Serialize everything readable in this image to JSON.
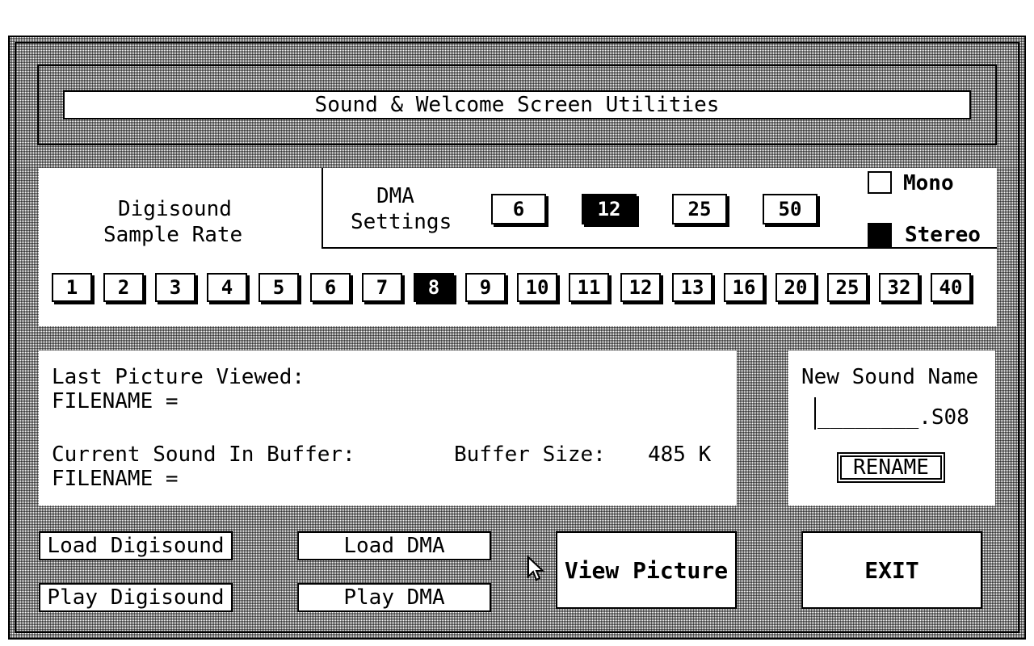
{
  "title": "Sound & Welcome Screen Utilities",
  "sample_rate": {
    "label_line1": "Digisound",
    "label_line2": "Sample Rate",
    "rates": [
      "1",
      "2",
      "3",
      "4",
      "5",
      "6",
      "7",
      "8",
      "9",
      "10",
      "11",
      "12",
      "13",
      "16",
      "20",
      "25",
      "32",
      "40"
    ],
    "selected": "8"
  },
  "dma": {
    "label_line1": "DMA",
    "label_line2": "Settings",
    "rates": [
      "6",
      "12",
      "25",
      "50"
    ],
    "selected": "12"
  },
  "channels": {
    "mono_label": "Mono",
    "stereo_label": "Stereo",
    "selected": "Stereo"
  },
  "info": {
    "last_picture_label": "Last Picture Viewed:",
    "filename_label_1": "FILENAME =",
    "current_sound_label": "Current Sound In Buffer:",
    "filename_label_2": "FILENAME =",
    "buffer_size_label": "Buffer Size:",
    "buffer_size_value": "485 K"
  },
  "rename": {
    "heading": "New Sound Name",
    "field_value": "________.S08",
    "button_label": "RENAME"
  },
  "actions": {
    "load_digisound": "Load Digisound",
    "play_digisound": "Play Digisound",
    "load_dma": "Load DMA",
    "play_dma": "Play DMA",
    "view_picture": "View Picture",
    "exit": "EXIT"
  }
}
